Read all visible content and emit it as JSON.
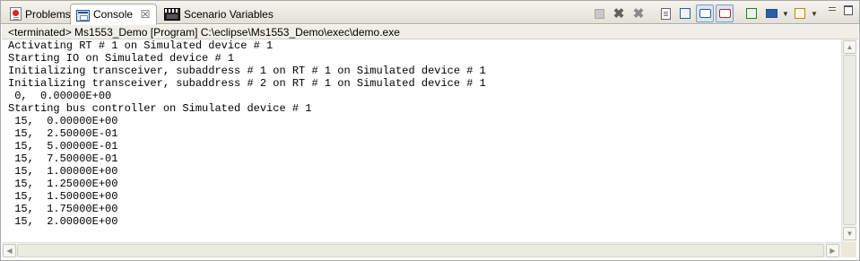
{
  "tabs": [
    {
      "label": "Problems",
      "icon": "problems-icon"
    },
    {
      "label": "Console",
      "icon": "console-icon",
      "active": true
    },
    {
      "label": "Scenario Variables",
      "icon": "clapperboard-icon"
    }
  ],
  "close_glyph": "☒",
  "status_line": "<terminated> Ms1553_Demo [Program] C:\\eclipse\\Ms1553_Demo\\exec\\demo.exe",
  "console_lines": [
    "Activating RT # 1 on Simulated device # 1",
    "Starting IO on Simulated device # 1",
    "Initializing transceiver, subaddress # 1 on RT # 1 on Simulated device # 1",
    "Initializing transceiver, subaddress # 2 on RT # 1 on Simulated device # 1",
    " 0,  0.00000E+00",
    "Starting bus controller on Simulated device # 1",
    " 15,  0.00000E+00",
    " 15,  2.50000E-01",
    " 15,  5.00000E-01",
    " 15,  7.50000E-01",
    " 15,  1.00000E+00",
    " 15,  1.25000E+00",
    " 15,  1.50000E+00",
    " 15,  1.75000E+00",
    " 15,  2.00000E+00"
  ],
  "toolbar_icons": [
    "terminate-icon",
    "remove-launch-icon",
    "remove-all-terminated-icon",
    "clear-console-icon",
    "scroll-lock-icon",
    "show-on-stdout-icon",
    "show-on-stderr-icon",
    "pin-console-icon",
    "display-console-icon",
    "open-console-icon"
  ],
  "window_controls": [
    "minimize-icon",
    "maximize-icon"
  ]
}
